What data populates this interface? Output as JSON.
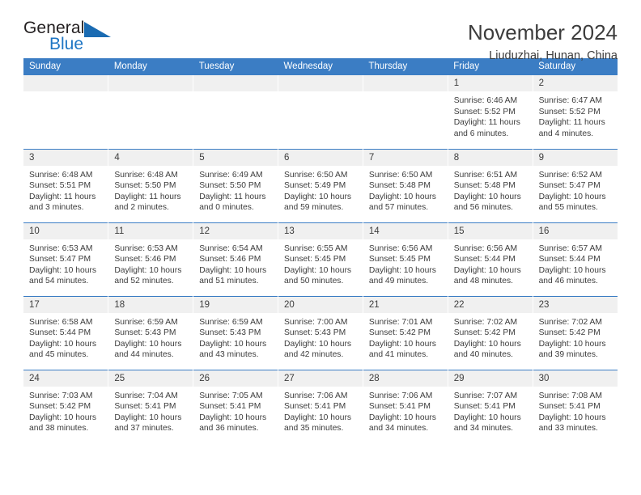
{
  "brand": {
    "name_top": "General",
    "name_bottom": "Blue",
    "triangle_color": "#1a6bb2",
    "blue_color": "#1f76c4"
  },
  "header": {
    "title": "November 2024",
    "subtitle": "Liuduzhai, Hunan, China"
  },
  "theme": {
    "header_blue": "#3b7dc4",
    "daynum_gray": "#f0f0f0",
    "text_color": "#3c3c3c"
  },
  "calendar": {
    "weekday_headers": [
      "Sunday",
      "Monday",
      "Tuesday",
      "Wednesday",
      "Thursday",
      "Friday",
      "Saturday"
    ],
    "weeks": [
      [
        {
          "day": "",
          "lines": []
        },
        {
          "day": "",
          "lines": []
        },
        {
          "day": "",
          "lines": []
        },
        {
          "day": "",
          "lines": []
        },
        {
          "day": "",
          "lines": []
        },
        {
          "day": "1",
          "lines": [
            "Sunrise: 6:46 AM",
            "Sunset: 5:52 PM",
            "Daylight: 11 hours",
            "and 6 minutes."
          ]
        },
        {
          "day": "2",
          "lines": [
            "Sunrise: 6:47 AM",
            "Sunset: 5:52 PM",
            "Daylight: 11 hours",
            "and 4 minutes."
          ]
        }
      ],
      [
        {
          "day": "3",
          "lines": [
            "Sunrise: 6:48 AM",
            "Sunset: 5:51 PM",
            "Daylight: 11 hours",
            "and 3 minutes."
          ]
        },
        {
          "day": "4",
          "lines": [
            "Sunrise: 6:48 AM",
            "Sunset: 5:50 PM",
            "Daylight: 11 hours",
            "and 2 minutes."
          ]
        },
        {
          "day": "5",
          "lines": [
            "Sunrise: 6:49 AM",
            "Sunset: 5:50 PM",
            "Daylight: 11 hours",
            "and 0 minutes."
          ]
        },
        {
          "day": "6",
          "lines": [
            "Sunrise: 6:50 AM",
            "Sunset: 5:49 PM",
            "Daylight: 10 hours",
            "and 59 minutes."
          ]
        },
        {
          "day": "7",
          "lines": [
            "Sunrise: 6:50 AM",
            "Sunset: 5:48 PM",
            "Daylight: 10 hours",
            "and 57 minutes."
          ]
        },
        {
          "day": "8",
          "lines": [
            "Sunrise: 6:51 AM",
            "Sunset: 5:48 PM",
            "Daylight: 10 hours",
            "and 56 minutes."
          ]
        },
        {
          "day": "9",
          "lines": [
            "Sunrise: 6:52 AM",
            "Sunset: 5:47 PM",
            "Daylight: 10 hours",
            "and 55 minutes."
          ]
        }
      ],
      [
        {
          "day": "10",
          "lines": [
            "Sunrise: 6:53 AM",
            "Sunset: 5:47 PM",
            "Daylight: 10 hours",
            "and 54 minutes."
          ]
        },
        {
          "day": "11",
          "lines": [
            "Sunrise: 6:53 AM",
            "Sunset: 5:46 PM",
            "Daylight: 10 hours",
            "and 52 minutes."
          ]
        },
        {
          "day": "12",
          "lines": [
            "Sunrise: 6:54 AM",
            "Sunset: 5:46 PM",
            "Daylight: 10 hours",
            "and 51 minutes."
          ]
        },
        {
          "day": "13",
          "lines": [
            "Sunrise: 6:55 AM",
            "Sunset: 5:45 PM",
            "Daylight: 10 hours",
            "and 50 minutes."
          ]
        },
        {
          "day": "14",
          "lines": [
            "Sunrise: 6:56 AM",
            "Sunset: 5:45 PM",
            "Daylight: 10 hours",
            "and 49 minutes."
          ]
        },
        {
          "day": "15",
          "lines": [
            "Sunrise: 6:56 AM",
            "Sunset: 5:44 PM",
            "Daylight: 10 hours",
            "and 48 minutes."
          ]
        },
        {
          "day": "16",
          "lines": [
            "Sunrise: 6:57 AM",
            "Sunset: 5:44 PM",
            "Daylight: 10 hours",
            "and 46 minutes."
          ]
        }
      ],
      [
        {
          "day": "17",
          "lines": [
            "Sunrise: 6:58 AM",
            "Sunset: 5:44 PM",
            "Daylight: 10 hours",
            "and 45 minutes."
          ]
        },
        {
          "day": "18",
          "lines": [
            "Sunrise: 6:59 AM",
            "Sunset: 5:43 PM",
            "Daylight: 10 hours",
            "and 44 minutes."
          ]
        },
        {
          "day": "19",
          "lines": [
            "Sunrise: 6:59 AM",
            "Sunset: 5:43 PM",
            "Daylight: 10 hours",
            "and 43 minutes."
          ]
        },
        {
          "day": "20",
          "lines": [
            "Sunrise: 7:00 AM",
            "Sunset: 5:43 PM",
            "Daylight: 10 hours",
            "and 42 minutes."
          ]
        },
        {
          "day": "21",
          "lines": [
            "Sunrise: 7:01 AM",
            "Sunset: 5:42 PM",
            "Daylight: 10 hours",
            "and 41 minutes."
          ]
        },
        {
          "day": "22",
          "lines": [
            "Sunrise: 7:02 AM",
            "Sunset: 5:42 PM",
            "Daylight: 10 hours",
            "and 40 minutes."
          ]
        },
        {
          "day": "23",
          "lines": [
            "Sunrise: 7:02 AM",
            "Sunset: 5:42 PM",
            "Daylight: 10 hours",
            "and 39 minutes."
          ]
        }
      ],
      [
        {
          "day": "24",
          "lines": [
            "Sunrise: 7:03 AM",
            "Sunset: 5:42 PM",
            "Daylight: 10 hours",
            "and 38 minutes."
          ]
        },
        {
          "day": "25",
          "lines": [
            "Sunrise: 7:04 AM",
            "Sunset: 5:41 PM",
            "Daylight: 10 hours",
            "and 37 minutes."
          ]
        },
        {
          "day": "26",
          "lines": [
            "Sunrise: 7:05 AM",
            "Sunset: 5:41 PM",
            "Daylight: 10 hours",
            "and 36 minutes."
          ]
        },
        {
          "day": "27",
          "lines": [
            "Sunrise: 7:06 AM",
            "Sunset: 5:41 PM",
            "Daylight: 10 hours",
            "and 35 minutes."
          ]
        },
        {
          "day": "28",
          "lines": [
            "Sunrise: 7:06 AM",
            "Sunset: 5:41 PM",
            "Daylight: 10 hours",
            "and 34 minutes."
          ]
        },
        {
          "day": "29",
          "lines": [
            "Sunrise: 7:07 AM",
            "Sunset: 5:41 PM",
            "Daylight: 10 hours",
            "and 34 minutes."
          ]
        },
        {
          "day": "30",
          "lines": [
            "Sunrise: 7:08 AM",
            "Sunset: 5:41 PM",
            "Daylight: 10 hours",
            "and 33 minutes."
          ]
        }
      ]
    ]
  }
}
